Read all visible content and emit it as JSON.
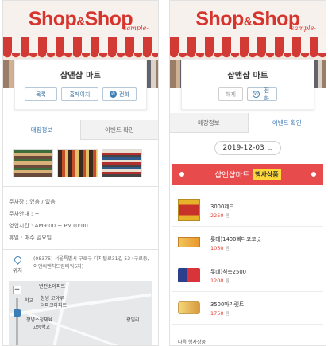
{
  "store": {
    "logo_main": "Shop",
    "logo_amp": "&",
    "logo_main2": "Shop",
    "logo_sub": "-sample-",
    "name": "샵앤샵 마트"
  },
  "left_page": {
    "buttons": {
      "news": "목록",
      "homepage": "홈페이지",
      "call": "전화"
    },
    "tabs": {
      "info": "매장정보",
      "event": "이벤트 확인"
    },
    "active_tab": "info",
    "info_lines": [
      "주차장 : 있음 / 없음",
      "주차안내 : ~",
      "영업시간 : AM9:00 ~ PM10:00",
      "휴일 : 매주 일요일"
    ],
    "address_label": "위치",
    "address": "(08375) 서울특별시 구로구 디지털로31길 53 (구로동, 이앤씨벤처드림타워5차)",
    "map": {
      "zoom_in": "+",
      "labels": {
        "l1": "변전소아파트",
        "l2": "창녕 코아루",
        "l3": "더파크아파트",
        "l4": "학교",
        "l5": "창녕소정체육",
        "l6": "고등학교",
        "l7": "광일리"
      }
    }
  },
  "right_page": {
    "buttons": {
      "close": "해제",
      "call": "전화"
    },
    "tabs": {
      "info": "매장정보",
      "event": "이벤트 확인"
    },
    "active_tab": "event",
    "date": "2019-12-03",
    "promo_title": "샵앤샵마트",
    "promo_badge": "행사상품",
    "currency": "원",
    "products": [
      {
        "name": "3000제크",
        "price": "2250"
      },
      {
        "name": "롯데)1400빠다코코넛",
        "price": "1050"
      },
      {
        "name": "롯데)칙촉2500",
        "price": "1200"
      },
      {
        "name": "3500마가렛트",
        "price": "1750"
      }
    ],
    "footer_partial": "다음 행사상품"
  },
  "colors": {
    "brand_red": "#d8342e",
    "accent_blue": "#3a78b5",
    "promo_red": "#e84b4b",
    "badge_yellow": "#ffd83a",
    "price_red": "#e1392d"
  }
}
